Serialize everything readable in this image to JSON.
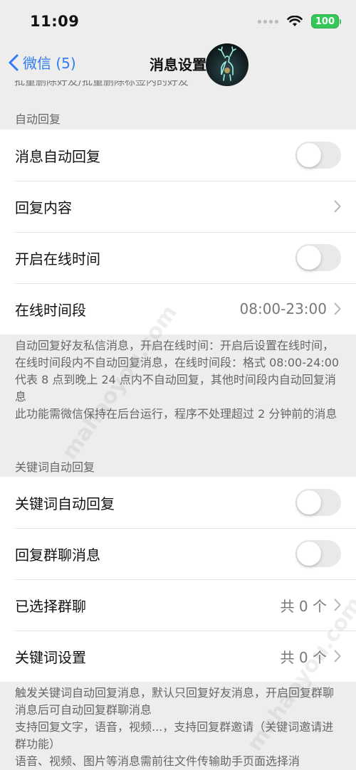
{
  "status_bar": {
    "time": "11:09",
    "battery": "100",
    "wifi_icon": "wifi-icon"
  },
  "nav": {
    "back_label": "微信 (5)",
    "title": "消息设置"
  },
  "peek_text": "批量删除好友/批量删除标签内的好友",
  "auto_reply": {
    "header": "自动回复",
    "rows": [
      {
        "label": "消息自动回复",
        "toggle": false
      },
      {
        "label": "回复内容"
      },
      {
        "label": "开启在线时间",
        "toggle": false
      },
      {
        "label": "在线时间段",
        "value": "08:00-23:00"
      }
    ],
    "footnote": [
      "自动回复好友私信消息，开启在线时间：开启后设置在线时间，在线时间段内不自动回复消息，在线时间段：格式 08:00-24:00代表 8 点到晚上 24 点内不自动回复，其他时间段内自动回复消息",
      "此功能需微信保持在后台运行，程序不处理超过 2 分钟前的消息"
    ]
  },
  "keyword_reply": {
    "header": "关键词自动回复",
    "rows": [
      {
        "label": "关键词自动回复",
        "toggle": false
      },
      {
        "label": "回复群聊消息",
        "toggle": false
      },
      {
        "label": "已选择群聊",
        "value": "共 0 个"
      },
      {
        "label": "关键词设置",
        "value": "共 0 个"
      }
    ],
    "footnote": [
      "触发关键词自动回复消息，默认只回复好友消息，开启回复群聊消息后可自动回复群聊消息",
      "支持回复文字，语音，视频...，支持回复群邀请（关键词邀请进群功能）",
      "语音、视频、图片等消息需前往文件传输助手页面选择消"
    ]
  },
  "watermark": "mahaoyou.com"
}
